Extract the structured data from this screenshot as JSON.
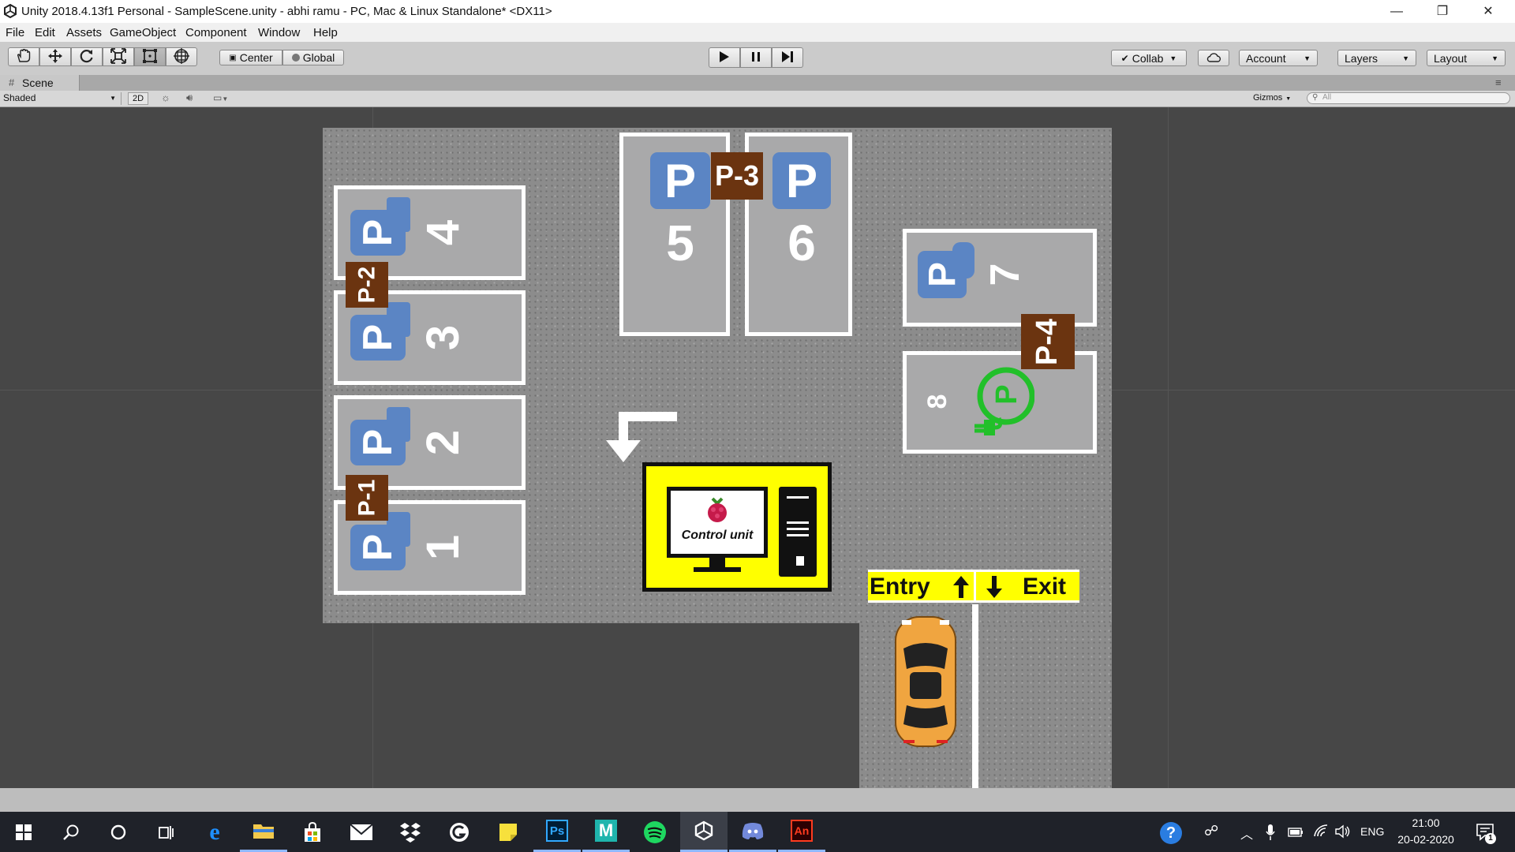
{
  "window": {
    "title": "Unity 2018.4.13f1 Personal - SampleScene.unity - abhi ramu - PC, Mac & Linux Standalone* <DX11>",
    "minimize_glyph": "—",
    "restore_glyph": "❐",
    "close_glyph": "✕"
  },
  "menu": {
    "items": [
      "File",
      "Edit",
      "Assets",
      "GameObject",
      "Component",
      "Window",
      "Help"
    ]
  },
  "toolbar": {
    "tools": [
      "hand-tool-icon",
      "move-tool-icon",
      "rotate-tool-icon",
      "scale-tool-icon",
      "rect-tool-icon",
      "transform-tool-icon"
    ],
    "pivot_label": "Center",
    "space_label": "Global",
    "collab_label": "Collab",
    "account_label": "Account",
    "layers_label": "Layers",
    "layout_label": "Layout"
  },
  "scene_tab": {
    "label": "Scene"
  },
  "scene_toolbar": {
    "shading_mode": "Shaded",
    "mode_2d": "2D",
    "gizmos_label": "Gizmos",
    "search_placeholder": "All"
  },
  "scene": {
    "parking_tags": [
      "P-1",
      "P-2",
      "P-3",
      "P-4"
    ],
    "slots": [
      "1",
      "2",
      "3",
      "4",
      "5",
      "6",
      "7",
      "8"
    ],
    "parking_badge": "P",
    "control_unit_label": "Control unit",
    "entry_label": "Entry",
    "exit_label": "Exit",
    "colors": {
      "asphalt": "#8c8c8c",
      "slot": "#a9a9aa",
      "badge_blue": "#5b85c4",
      "tag_brown": "#6b3410",
      "sign_yellow": "#ffff00",
      "ev_green": "#22c02a",
      "car_orange": "#f0a540"
    }
  },
  "taskbar": {
    "apps": [
      "windows-start-icon",
      "search-icon",
      "cortana-icon",
      "task-view-icon",
      "edge-icon",
      "file-explorer-icon",
      "store-icon",
      "mail-icon",
      "dropbox-icon",
      "logitech-icon",
      "sticky-notes-icon",
      "photoshop-icon",
      "maya-icon",
      "spotify-icon",
      "unity-icon",
      "discord-icon",
      "animate-icon"
    ],
    "photoshop_label": "Ps",
    "maya_label": "M",
    "animate_label": "An",
    "language": "ENG",
    "time": "21:00",
    "date": "20-02-2020",
    "notification_count": "1"
  }
}
